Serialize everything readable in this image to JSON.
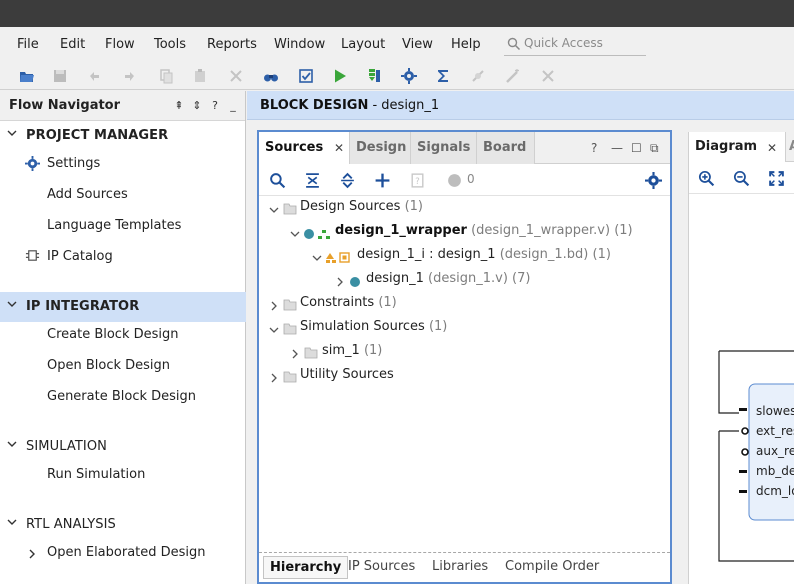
{
  "menu": {
    "file": "File",
    "edit": "Edit",
    "flow": "Flow",
    "tools": "Tools",
    "reports": "Reports",
    "window": "Window",
    "layout": "Layout",
    "view": "View",
    "help": "Help"
  },
  "quick_access": {
    "placeholder": "Quick Access"
  },
  "flow_navigator": {
    "title": "Flow Navigator",
    "sections": [
      {
        "label": "PROJECT MANAGER",
        "items": [
          "Settings",
          "Add Sources",
          "Language Templates",
          "IP Catalog"
        ]
      },
      {
        "label": "IP INTEGRATOR",
        "items": [
          "Create Block Design",
          "Open Block Design",
          "Generate Block Design"
        ]
      },
      {
        "label": "SIMULATION",
        "items": [
          "Run Simulation"
        ]
      },
      {
        "label": "RTL ANALYSIS",
        "items": [
          "Open Elaborated Design"
        ]
      }
    ]
  },
  "block_design": {
    "title": "BLOCK DESIGN",
    "name": " - design_1"
  },
  "sources": {
    "tabs": [
      "Sources",
      "Design",
      "Signals",
      "Board"
    ],
    "status_count": "0",
    "tree": {
      "design_sources": "Design Sources",
      "design_sources_count": "(1)",
      "wrapper": "design_1_wrapper",
      "wrapper_file": "(design_1_wrapper.v) (1)",
      "design_1_i": "design_1_i : design_1",
      "design_1_i_file": "(design_1.bd) (1)",
      "design_1": "design_1",
      "design_1_file": "(design_1.v) (7)",
      "constraints": "Constraints",
      "constraints_count": "(1)",
      "simulation_sources": "Simulation Sources",
      "simulation_sources_count": "(1)",
      "sim_1": "sim_1",
      "sim_1_count": "(1)",
      "utility_sources": "Utility Sources"
    },
    "bottom_tabs": [
      "Hierarchy",
      "IP Sources",
      "Libraries",
      "Compile Order"
    ]
  },
  "diagram": {
    "tab": "Diagram",
    "next_tab": "A",
    "ports": [
      "slowes",
      "ext_res",
      "aux_re",
      "mb_de",
      "dcm_lo"
    ]
  },
  "colors": {
    "accent_blue": "#5b8bd0",
    "active_bg": "#cfe0f7",
    "green": "#3aa63a",
    "dark_title": "#3c3c3c"
  }
}
